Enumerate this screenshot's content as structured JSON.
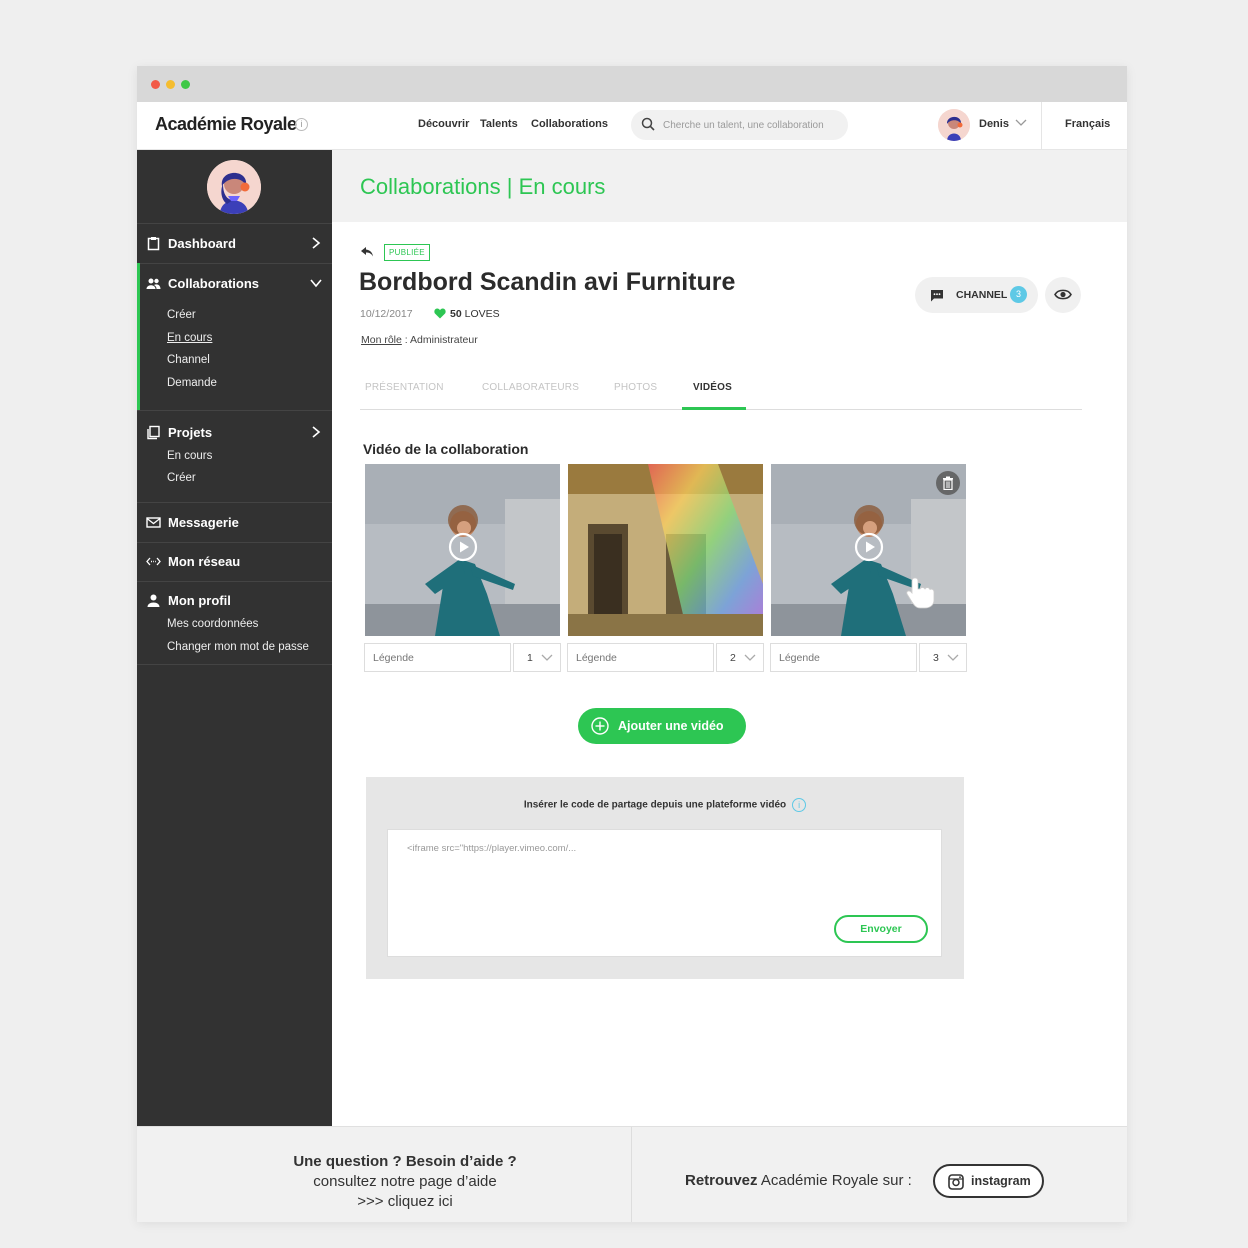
{
  "app": {
    "logo": "Académie Royale",
    "logo_info": "i"
  },
  "topnav": {
    "links": [
      "Découvrir",
      "Talents",
      "Collaborations"
    ],
    "search_placeholder": "Cherche un talent, une collaboration",
    "user_name": "Denis",
    "language": "Français"
  },
  "sidebar": {
    "dashboard": "Dashboard",
    "collaborations": {
      "label": "Collaborations",
      "items": [
        "Créer",
        "En cours",
        "Channel",
        "Demande"
      ],
      "active_item": "En cours"
    },
    "projets": {
      "label": "Projets",
      "items": [
        "En cours",
        "Créer"
      ]
    },
    "messagerie": "Messagerie",
    "reseau": "Mon réseau",
    "profil": {
      "label": "Mon profil",
      "items": [
        "Mes coordonnées",
        "Changer mon mot de passe"
      ]
    }
  },
  "header": {
    "title": "Collaborations",
    "separator": "|",
    "subtitle": "En cours"
  },
  "project": {
    "status_badge": "PUBLIÉE",
    "title": "Bordbord Scandin avi Furniture",
    "date": "10/12/2017",
    "loves_count": "50",
    "loves_label": "LOVES",
    "role_label": "Mon rôle",
    "role_value": " : Administrateur",
    "channel_label": "CHANNEL",
    "channel_count": "3"
  },
  "tabs": [
    "PRÉSENTATION",
    "COLLABORATEURS",
    "PHOTOS",
    "VIDÉOS"
  ],
  "active_tab": "VIDÉOS",
  "videos": {
    "section_title": "Vidéo de la collaboration",
    "items": [
      {
        "legend_placeholder": "Légende",
        "order": "1"
      },
      {
        "legend_placeholder": "Légende",
        "order": "2"
      },
      {
        "legend_placeholder": "Légende",
        "order": "3"
      }
    ],
    "add_button": "Ajouter une vidéo"
  },
  "embed": {
    "label": "Insérer le code de partage depuis une plateforme vidéo",
    "info": "i",
    "placeholder": "<iframe src=\"https://player.vimeo.com/...",
    "send_button": "Envoyer"
  },
  "footer": {
    "help_question": "Une question ? Besoin d’aide ?",
    "help_line2": "consultez notre page d’aide",
    "help_line3": ">>> cliquez ici",
    "follow_bold": "Retrouvez",
    "follow_rest": " Académie Royale sur :",
    "instagram": "instagram"
  },
  "colors": {
    "accent": "#2dc653",
    "sidebar_bg": "#323232",
    "info_blue": "#5ec9e6"
  }
}
